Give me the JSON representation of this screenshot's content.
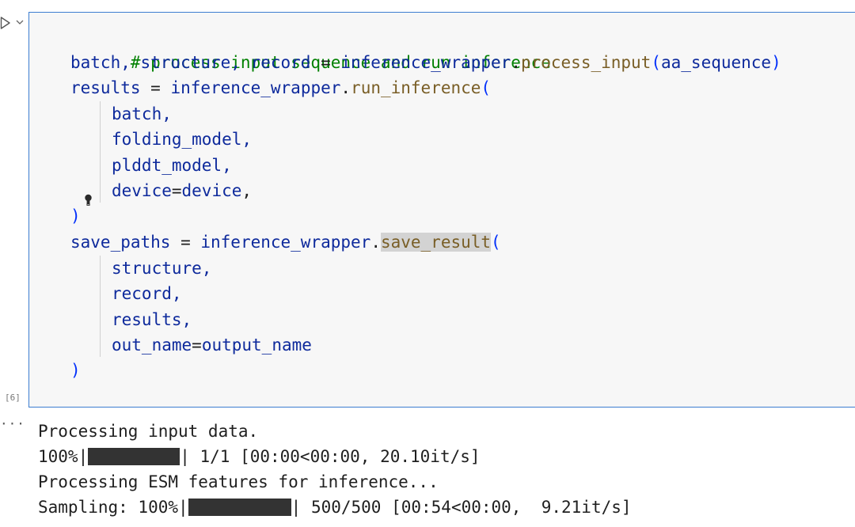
{
  "cell": {
    "execution_count": "[6]",
    "comment": "# process input sequence and run inference",
    "line2": {
      "lhs": "batch, structure, record",
      "eq": " = ",
      "obj": "inference_wrapper",
      "dot": ".",
      "method": "process_input",
      "open": "(",
      "arg": "aa_sequence",
      "close": ")"
    },
    "line3": {
      "lhs": "results",
      "eq": " = ",
      "obj": "inference_wrapper",
      "dot": ".",
      "method": "run_inference",
      "open": "("
    },
    "run_args": [
      "batch,",
      "folding_model,",
      "plddt_model,"
    ],
    "device_arg": {
      "key": "device",
      "eq": "=",
      "val": "device",
      "comma": ","
    },
    "close_paren": ")",
    "line9": {
      "lhs": "save_paths",
      "eq": " = ",
      "obj": "inference_wrapper",
      "dot": ".",
      "method": "save_result",
      "open": "("
    },
    "save_args": [
      "structure,",
      "record,",
      "results,"
    ],
    "out_arg": {
      "key": "out_name",
      "eq": "=",
      "val": "output_name"
    },
    "close_paren2": ")"
  },
  "output": {
    "more_glyph": "···",
    "line1": "Processing input data.",
    "line2_prefix": "100%|",
    "line2_suffix": "| 1/1 [00:00<00:00, 20.10it/s]",
    "line2_progress": 1.0,
    "line3": "Processing ESM features for inference...",
    "line4_prefix": "Sampling: 100%|",
    "line4_suffix": "| 500/500 [00:54<00:00,  9.21it/s]",
    "line4_progress": 1.0
  },
  "icons": {
    "run": "run-triangle-icon",
    "chevron": "chevron-down-icon",
    "bulb": "lightbulb-icon"
  },
  "colors": {
    "cell_border": "#3c7dd0",
    "comment": "#008000",
    "variable": "#0e2a9c",
    "function": "#795e26",
    "bracket": "#0431fa",
    "progress_bar": "#333333"
  }
}
